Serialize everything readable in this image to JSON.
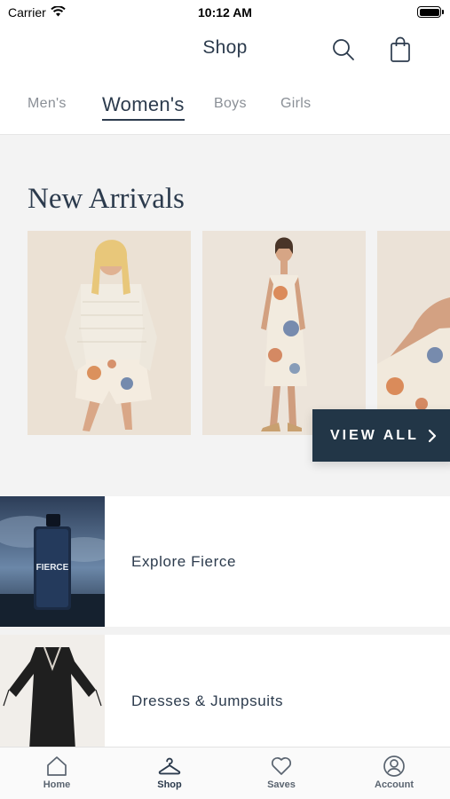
{
  "status_bar": {
    "carrier": "Carrier",
    "time": "10:12 AM"
  },
  "header": {
    "title": "Shop",
    "icons": [
      "search-icon",
      "shopping-bag-icon"
    ]
  },
  "tabs": [
    {
      "label": "Men's",
      "active": false
    },
    {
      "label": "Women's",
      "active": true
    },
    {
      "label": "Boys",
      "active": false
    },
    {
      "label": "Girls",
      "active": false
    }
  ],
  "new_arrivals": {
    "title": "New Arrivals",
    "view_all_label": "VIEW ALL"
  },
  "categories": [
    {
      "label": "Explore Fierce",
      "thumb_text": "FIERCE"
    },
    {
      "label": "Dresses & Jumpsuits"
    }
  ],
  "bottom_nav": [
    {
      "label": "Home",
      "icon": "home-icon",
      "active": false
    },
    {
      "label": "Shop",
      "icon": "hanger-icon",
      "active": true
    },
    {
      "label": "Saves",
      "icon": "heart-icon",
      "active": false
    },
    {
      "label": "Account",
      "icon": "account-icon",
      "active": false
    }
  ],
  "colors": {
    "accent": "#223647",
    "panel_bg": "#f3f3f3",
    "text": "#2c3b4d"
  }
}
